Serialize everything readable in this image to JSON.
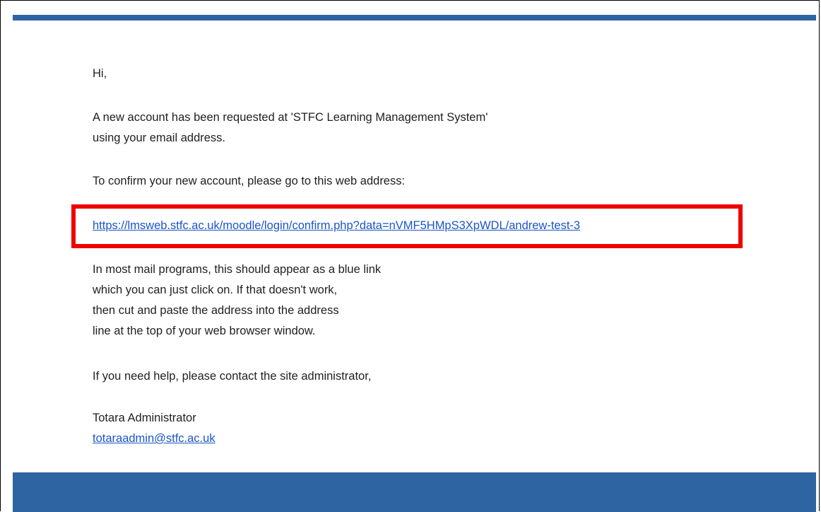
{
  "email": {
    "greeting": "Hi,",
    "intro_lines": [
      "A new account has been requested at 'STFC Learning Management System'",
      "using your email address."
    ],
    "confirm_instruction": "To confirm your new account, please go to this web address:",
    "confirm_link": "https://lmsweb.stfc.ac.uk/moodle/login/confirm.php?data=nVMF5HMpS3XpWDL/andrew-test-3",
    "mail_program_lines": [
      "In most mail programs, this should appear as a blue link",
      "which you can just click on. If that doesn't work,",
      "then cut and paste the address into the address",
      "line at the top of your web browser window."
    ],
    "help_text": "If you need help, please contact the site administrator,",
    "signature_name": "Totara Administrator",
    "signature_email": "totaraadmin@stfc.ac.uk"
  },
  "colors": {
    "header_bar": "#2e64a2",
    "footer_bar": "#2e64a2",
    "link": "#1a55c8",
    "highlight_border": "#ee0000",
    "text": "#1f1f1f"
  }
}
